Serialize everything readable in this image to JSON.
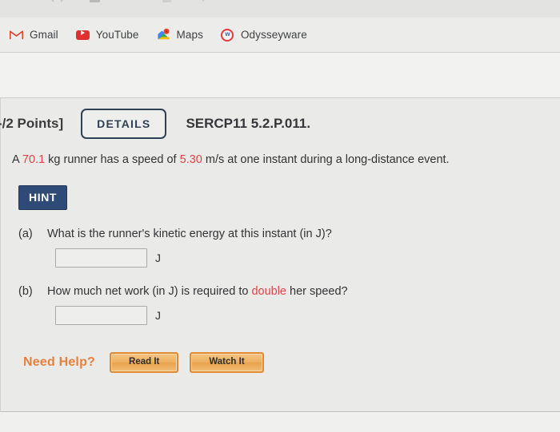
{
  "browser": {
    "bookmarks": [
      {
        "label": "Gmail",
        "icon": "gmail-icon"
      },
      {
        "label": "YouTube",
        "icon": "youtube-icon"
      },
      {
        "label": "Maps",
        "icon": "maps-icon"
      },
      {
        "label": "Odysseyware",
        "icon": "odysseyware-icon"
      }
    ]
  },
  "question": {
    "points_label": "-/2 Points]",
    "details_label": "DETAILS",
    "code": "SERCP11 5.2.P.011.",
    "statement": {
      "pre": "A ",
      "mass": "70.1",
      "mid": " kg runner has a speed of ",
      "speed": "5.30",
      "post": " m/s at one instant during a long-distance event."
    },
    "hint_label": "HINT",
    "parts": [
      {
        "letter": "(a)",
        "pre": "What is the runner's kinetic energy at this instant (in J)?",
        "emphasis": "",
        "post": "",
        "answer_value": "",
        "answer_placeholder": "",
        "unit": "J"
      },
      {
        "letter": "(b)",
        "pre": "How much net work (in J) is required to ",
        "emphasis": "double",
        "post": " her speed?",
        "answer_value": "",
        "answer_placeholder": "",
        "unit": "J"
      }
    ],
    "need_help": {
      "label": "Need Help?",
      "read_label": "Read It",
      "watch_label": "Watch It"
    }
  },
  "colors": {
    "page_background": "#eaeae8",
    "highlight_value": "#e04545",
    "hint_background": "#2e4a77",
    "details_border": "#2f4154",
    "need_help_text": "#e8803e",
    "help_button_border": "#e08a33"
  }
}
